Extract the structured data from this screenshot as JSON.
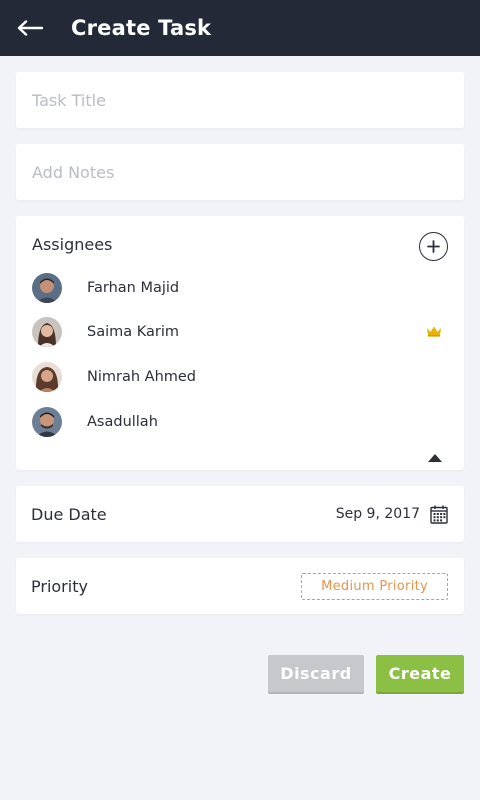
{
  "header": {
    "title": "Create Task"
  },
  "form": {
    "title_placeholder": "Task Title",
    "notes_placeholder": "Add Notes"
  },
  "assignees": {
    "label": "Assignees",
    "people": [
      {
        "name": "Farhan Majid",
        "crown": false
      },
      {
        "name": "Saima Karim",
        "crown": true
      },
      {
        "name": "Nimrah Ahmed",
        "crown": false
      },
      {
        "name": "Asadullah",
        "crown": false
      }
    ]
  },
  "due_date": {
    "label": "Due Date",
    "value": "Sep 9, 2017"
  },
  "priority": {
    "label": "Priority",
    "value": "Medium Priority"
  },
  "actions": {
    "discard_label": "Discard",
    "create_label": "Create"
  },
  "colors": {
    "appbar": "#232936",
    "background": "#f1f3f8",
    "priority_accent": "#e6954a",
    "create_button": "#8cc045",
    "discard_button": "#c7c8cc",
    "crown": "#e8b400"
  },
  "icons": {
    "back": "arrow-left-icon",
    "add": "plus-icon",
    "crown": "crown-icon",
    "collapse": "caret-up-icon",
    "calendar": "calendar-icon"
  }
}
